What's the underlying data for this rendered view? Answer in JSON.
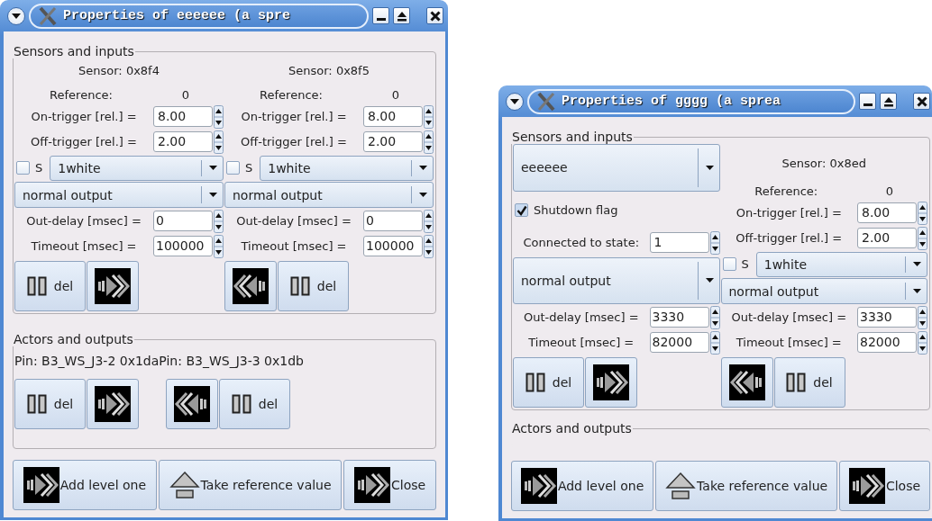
{
  "windows": [
    {
      "title": "Properties of eeeeee (a spre",
      "sensors": {
        "title": "Sensors and inputs",
        "columns": [
          {
            "kind": "sensor",
            "sensor": "Sensor: 0x8f4",
            "reference_label": "Reference:",
            "reference_value": "0",
            "on_trigger": {
              "label": "On-trigger [rel.] =",
              "value": "8.00"
            },
            "off_trigger": {
              "label": "Off-trigger [rel.] =",
              "value": "2.00"
            },
            "s_checkbox": {
              "label": "S",
              "checked": false
            },
            "color_choice": "1white",
            "output": "normal output",
            "out_delay": {
              "label": "Out-delay [msec] =",
              "value": "0"
            },
            "timeout": {
              "label": "Timeout [msec] =",
              "value": "100000"
            },
            "buttons": [
              {
                "kind": "del",
                "label": "del"
              },
              {
                "kind": "forward"
              }
            ]
          },
          {
            "kind": "sensor",
            "sensor": "Sensor: 0x8f5",
            "reference_label": "Reference:",
            "reference_value": "0",
            "on_trigger": {
              "label": "On-trigger [rel.] =",
              "value": "8.00"
            },
            "off_trigger": {
              "label": "Off-trigger [rel.] =",
              "value": "2.00"
            },
            "s_checkbox": {
              "label": "S",
              "checked": false
            },
            "color_choice": "1white",
            "output": "normal output",
            "out_delay": {
              "label": "Out-delay [msec] =",
              "value": "0"
            },
            "timeout": {
              "label": "Timeout [msec] =",
              "value": "100000"
            },
            "buttons": [
              {
                "kind": "back"
              },
              {
                "kind": "del",
                "label": "del"
              }
            ]
          }
        ]
      },
      "actors": {
        "title": "Actors and outputs",
        "pins": [
          "Pin: B3_WS_J3-2 0x1da",
          "Pin: B3_WS_J3-3 0x1db"
        ],
        "button_groups": [
          [
            {
              "kind": "del",
              "label": "del"
            },
            {
              "kind": "forward"
            }
          ],
          [
            {
              "kind": "back"
            },
            {
              "kind": "del",
              "label": "del"
            }
          ]
        ]
      },
      "footer": [
        {
          "kind": "forward",
          "label": "Add level one"
        },
        {
          "kind": "eject",
          "label": "Take reference value"
        },
        {
          "kind": "forward",
          "label": "Close"
        }
      ]
    },
    {
      "title": "Properties of gggg (a sprea",
      "sensors": {
        "title": "Sensors and inputs",
        "columns": [
          {
            "kind": "state",
            "sensor_select": "eeeeee",
            "shutdown": {
              "label": "Shutdown flag",
              "checked": true
            },
            "connected": {
              "label": "Connected to state:",
              "value": "1"
            },
            "output": "normal output",
            "out_delay": {
              "label": "Out-delay [msec] =",
              "value": "3330"
            },
            "timeout": {
              "label": "Timeout [msec] =",
              "value": "82000"
            },
            "buttons": [
              {
                "kind": "del",
                "label": "del"
              },
              {
                "kind": "forward"
              }
            ]
          },
          {
            "kind": "sensor",
            "sensor": "Sensor: 0x8ed",
            "reference_label": "Reference:",
            "reference_value": "0",
            "on_trigger": {
              "label": "On-trigger [rel.] =",
              "value": "8.00"
            },
            "off_trigger": {
              "label": "Off-trigger [rel.] =",
              "value": "2.00"
            },
            "s_checkbox": {
              "label": "S",
              "checked": false
            },
            "color_choice": "1white",
            "output": "normal output",
            "out_delay": {
              "label": "Out-delay [msec] =",
              "value": "3330"
            },
            "timeout": {
              "label": "Timeout [msec] =",
              "value": "82000"
            },
            "buttons": [
              {
                "kind": "back"
              },
              {
                "kind": "del",
                "label": "del"
              }
            ]
          }
        ]
      },
      "actors": {
        "title": "Actors and outputs"
      },
      "footer": [
        {
          "kind": "forward",
          "label": "Add level one"
        },
        {
          "kind": "eject",
          "label": "Take reference value"
        },
        {
          "kind": "forward",
          "label": "Close"
        }
      ]
    }
  ]
}
